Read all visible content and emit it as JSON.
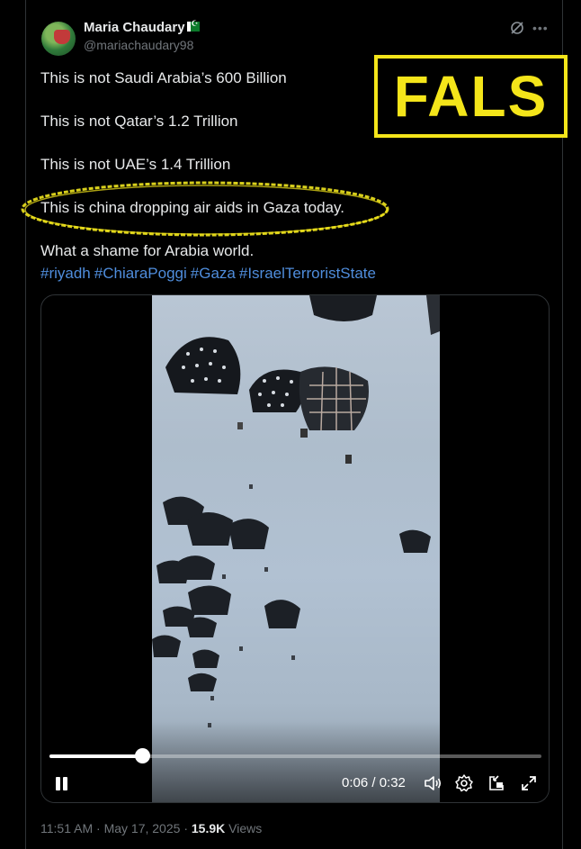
{
  "author": {
    "name": "Maria Chaudary",
    "handle": "@mariachaudary98"
  },
  "tweet": {
    "lines": [
      "This is not Saudi Arabia’s 600 Billion",
      "This is not Qatar’s 1.2 Trillion",
      "This is not UAE’s 1.4 Trillion",
      "This is china dropping air aids in Gaza today.",
      "What a shame for Arabia world."
    ],
    "hashtags": [
      "#riyadh",
      "#ChiaraPoggi",
      "#Gaza",
      "#IsraelTerroristState"
    ]
  },
  "overlay": {
    "label": "FALS",
    "color": "#f4e51a"
  },
  "video": {
    "time": "0:06 / 0:32",
    "progress": 0.1875,
    "icons": [
      "pause-icon",
      "volume-icon",
      "settings-icon",
      "picture-in-picture-icon",
      "fullscreen-icon"
    ]
  },
  "footer": {
    "time": "11:51 AM",
    "separator1": "·",
    "date": "May 17, 2025",
    "separator2": "·",
    "views_count": "15.9K",
    "views_label": "Views"
  },
  "colors": {
    "background": "#000000",
    "text": "#e7e9ea",
    "muted": "#71767b",
    "link": "#4f8ddc"
  }
}
